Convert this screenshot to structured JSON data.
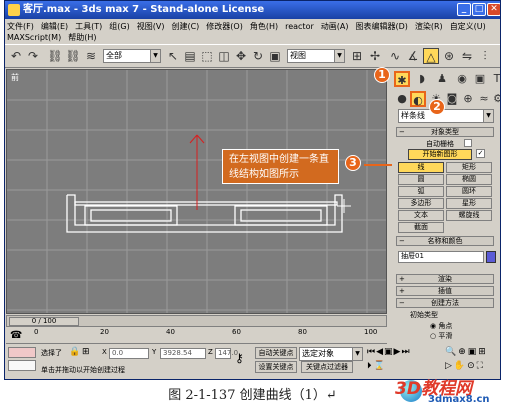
{
  "window": {
    "title": "客厅.max - 3ds max 7  - Stand-alone License",
    "min": "_",
    "max": "□",
    "close": "✕"
  },
  "menu": {
    "row1": [
      "文件(F)",
      "编辑(E)",
      "工具(T)",
      "组(G)",
      "视图(V)",
      "创建(C)",
      "修改器(O)",
      "角色(H)",
      "reactor",
      "动画(A)",
      "图表编辑器(D)",
      "渲染(R)",
      "自定义(U)"
    ],
    "row2": [
      "MAXScript(M)",
      "帮助(H)"
    ]
  },
  "toolbar": {
    "selection_filter": "全部",
    "ref_coord": "视图"
  },
  "viewport": {
    "label": "前"
  },
  "command_panel": {
    "category": "样条线",
    "object_type_header": "对象类型",
    "auto_grid_label": "自动栅格",
    "start_new_shape": "开始新图形",
    "shape_buttons": [
      "线",
      "矩形",
      "圆",
      "椭圆",
      "弧",
      "圆环",
      "多边形",
      "星形",
      "文本",
      "螺旋线",
      "截面"
    ],
    "name_color_header": "名称和颜色",
    "object_name": "抽屉01",
    "rendering_header": "渲染",
    "interpolation_header": "插值",
    "creation_method_header": "创建方法",
    "initial_type_label": "初始类型",
    "corner": "角点",
    "smooth": "平滑"
  },
  "timeline": {
    "frame": "0 / 100",
    "ticks": [
      "0",
      "20",
      "40",
      "60",
      "80",
      "100"
    ]
  },
  "status": {
    "selection": "选择了",
    "x": "0.0",
    "y": "3928.54",
    "z": "147.0",
    "auto_key": "自动关键点",
    "set_key": "设置关键点",
    "selected_object": "选定对象",
    "key_filters": "关键点过滤器",
    "prompt": "单击并拖动以开始创建过程",
    "x_label": "X",
    "y_label": "Y",
    "z_label": "Z"
  },
  "callouts": [
    "1",
    "2",
    "3"
  ],
  "annotation": "在左视图中创建一条直线结构如图所示",
  "caption": "图 2-1-137   创建曲线（1）↵",
  "watermark": {
    "brand": "3D教程网",
    "url": "3dmax8.cn"
  },
  "colors": {
    "viewport_bg": "#7d7d7d",
    "highlight": "#ffd85a",
    "callout": "#e8651a",
    "object_color": "#5b5bd6"
  }
}
